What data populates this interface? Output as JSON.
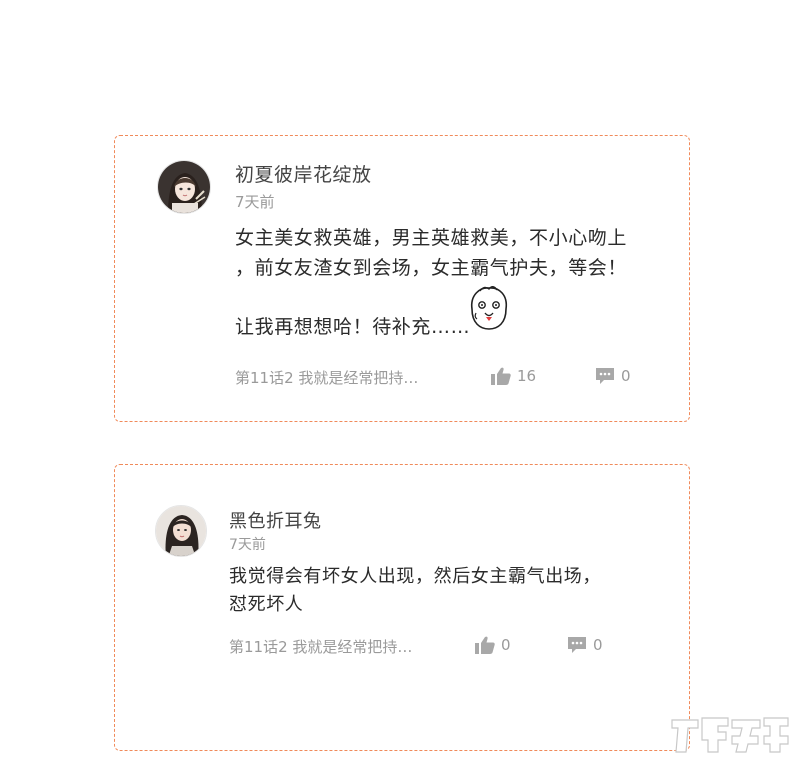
{
  "comments": [
    {
      "username": "初夏彼岸花绽放",
      "time": "7天前",
      "content_lines": [
        "女主美女救英雄，男主英雄救美，不小心吻上",
        "，前女友渣女到会场，女主霸气护夫，等会！",
        "",
        "让我再想想哈！待补充……"
      ],
      "chapter": "第11话2 我就是经常把持…",
      "likes": "16",
      "replies": "0",
      "avatar_icon": "avatar-girl-icon",
      "sticker_icon": "sticker-face-icon"
    },
    {
      "username": "黑色折耳兔",
      "time": "7天前",
      "content_lines": [
        "我觉得会有坏女人出现，然后女主霸气出场，",
        "怼死坏人"
      ],
      "chapter": "第11话2 我就是经常把持…",
      "likes": "0",
      "replies": "0",
      "avatar_icon": "avatar-girl-icon"
    }
  ],
  "colors": {
    "card_border": "#f08a5a",
    "meta_text": "#9a9a9a",
    "body_text": "#2b2b2b"
  },
  "icons": {
    "like": "thumbs-up-icon",
    "reply": "comment-bubble-icon",
    "watermark": "watermark-logo"
  }
}
